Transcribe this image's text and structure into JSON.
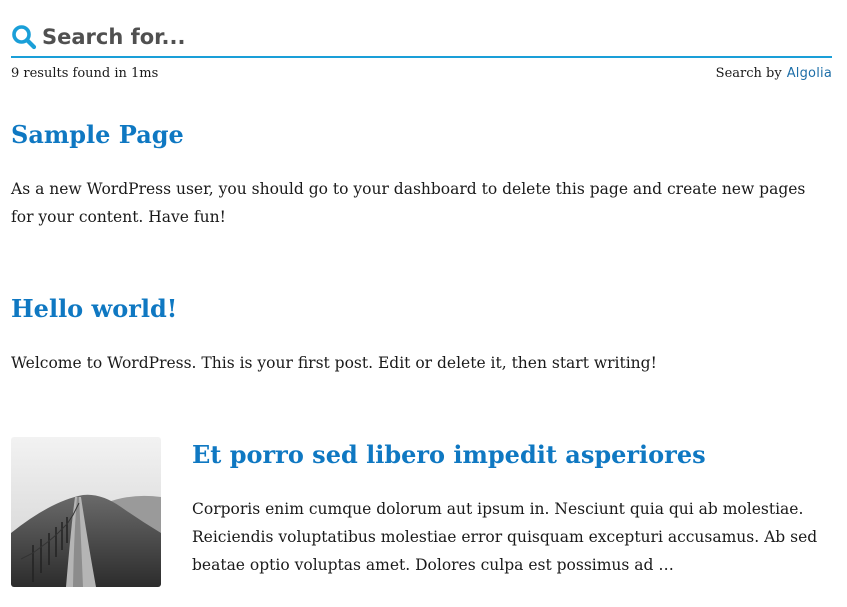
{
  "search": {
    "placeholder": "Search for...",
    "value": "",
    "results_stats": "9 results found in 1ms",
    "powered_by_label": "Search by",
    "powered_by_brand": "Algolia"
  },
  "colors": {
    "accent": "#1a9fd8",
    "title": "#0f78c2",
    "brand": "#1d6ea8"
  },
  "results": [
    {
      "title": "Sample Page",
      "excerpt": "As a new WordPress user, you should go to your dashboard to delete this page and create new pages for your content. Have fun!"
    },
    {
      "title": "Hello world!",
      "excerpt": "Welcome to WordPress. This is your first post. Edit or delete it, then start writing!"
    },
    {
      "title": "Et porro sed libero impedit asperiores",
      "excerpt": "Corporis enim cumque dolorum aut ipsum in. Nesciunt quia qui ab molestiae. Reiciendis voluptatibus molestiae error quisquam excepturi accusamus. Ab sed beatae optio voluptas amet. Dolores culpa est possimus ad …",
      "thumbnail": "grayscale-hill-path-photo"
    }
  ]
}
